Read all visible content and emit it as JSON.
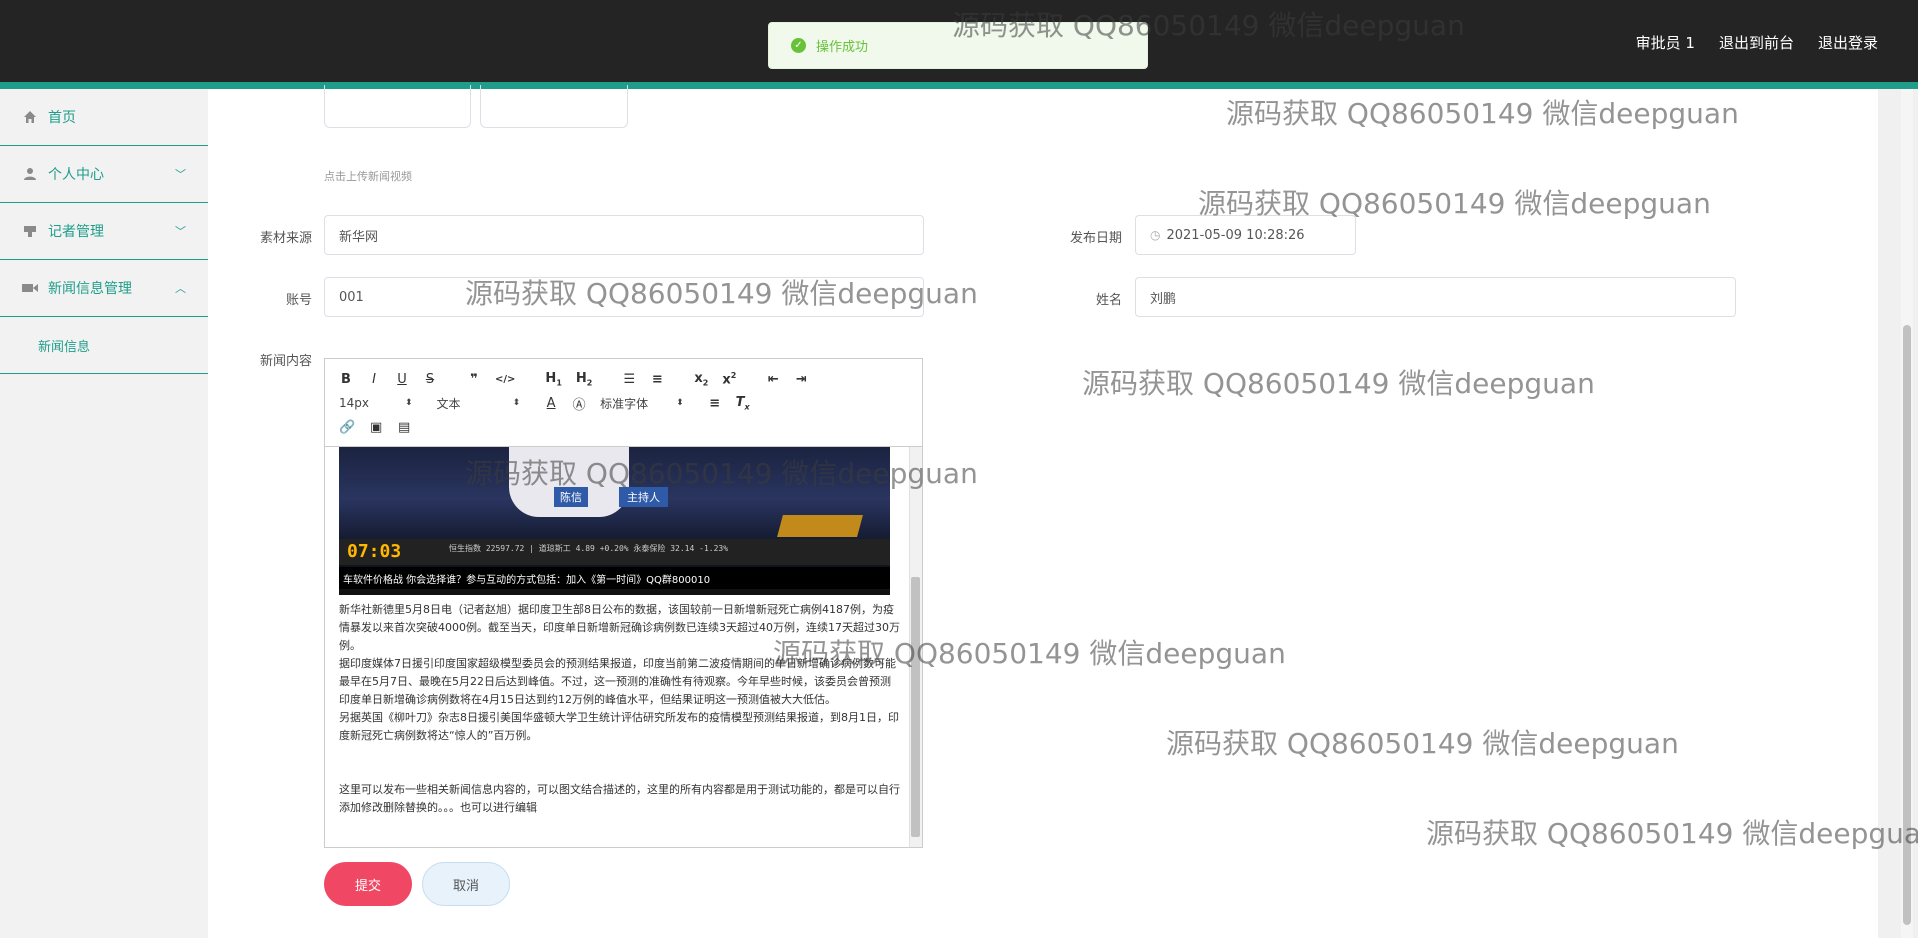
{
  "topnav": {
    "user": "审批员 1",
    "to_front": "退出到前台",
    "logout": "退出登录"
  },
  "toast": {
    "message": "操作成功",
    "icon": "check-circle-icon",
    "color": "#67c23a"
  },
  "sidebar": {
    "items": [
      {
        "label": "首页",
        "icon": "home-icon"
      },
      {
        "label": "个人中心",
        "icon": "user-icon"
      },
      {
        "label": "记者管理",
        "icon": "reporter-icon"
      },
      {
        "label": "新闻信息管理",
        "icon": "video-icon"
      }
    ],
    "sub_items": [
      {
        "label": "新闻信息"
      }
    ],
    "accent": "#1e9e8a"
  },
  "form": {
    "upload_hint": "点击上传新闻视频",
    "source_label": "素材来源",
    "source_value": "新华网",
    "date_label": "发布日期",
    "date_value": "2021-05-09 10:28:26",
    "account_label": "账号",
    "account_value": "001",
    "name_label": "姓名",
    "name_value": "刘鹏",
    "content_label": "新闻内容"
  },
  "editor": {
    "font_size": "14px",
    "block_type": "文本",
    "font_family": "标准字体",
    "video": {
      "name_tag": "陈信",
      "name_tag2": "主持人",
      "clock": "07:03",
      "ticker": "恒生指数 22597.72 | 道琼斯工 4.89 +0.20% 永泰保险 32.14 -1.23%",
      "bottom": "车软件价格战 你会选择谁？参与互动的方式包括：加入《第一时间》QQ群800010"
    },
    "paragraphs": [
      "新华社新德里5月8日电（记者赵旭）据印度卫生部8日公布的数据，该国较前一日新增新冠死亡病例4187例，为疫情暴发以来首次突破4000例。截至当天，印度单日新增新冠确诊病例数已连续3天超过40万例，连续17天超过30万例。",
      "据印度媒体7日援引印度国家超级模型委员会的预测结果报道，印度当前第二波疫情期间的单日新增确诊病例数可能最早在5月7日、最晚在5月22日后达到峰值。不过，这一预测的准确性有待观察。今年早些时候，该委员会曾预测印度单日新增确诊病例数将在4月15日达到约12万例的峰值水平，但结果证明这一预测值被大大低估。",
      "另据英国《柳叶刀》杂志8日援引美国华盛顿大学卫生统计评估研究所发布的疫情模型预测结果报道，到8月1日，印度新冠死亡病例数将达“惊人的”百万例。"
    ],
    "closing": "这里可以发布一些相关新闻信息内容的，可以图文结合描述的，这里的所有内容都是用于测试功能的，都是可以自行添加修改删除替换的。。。也可以进行编辑"
  },
  "buttons": {
    "submit": "提交",
    "cancel": "取消",
    "submit_color": "#f04864"
  },
  "watermark": "源码获取 QQ86050149 微信deepguan"
}
